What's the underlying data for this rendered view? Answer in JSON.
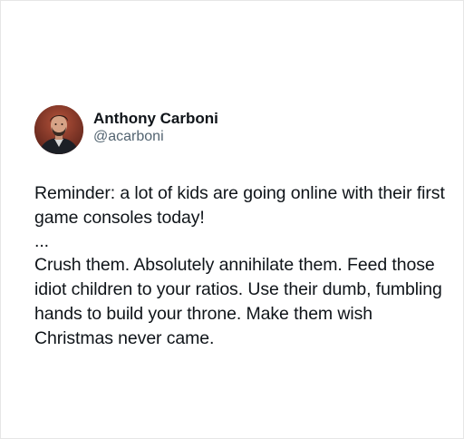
{
  "tweet": {
    "author": {
      "display_name": "Anthony Carboni",
      "handle": "@acarboni",
      "avatar_icon": "profile-photo"
    },
    "paragraphs": [
      "Reminder: a lot of kids are going online with their first game consoles today!",
      "...",
      "Crush them. Absolutely annihilate them. Feed those idiot children to your ratios. Use their dumb, fumbling hands to build your throne. Make them wish Christmas never came."
    ]
  },
  "colors": {
    "text": "#0f1419",
    "secondary_text": "#536471",
    "background": "#ffffff",
    "border": "#e6e6e6"
  }
}
